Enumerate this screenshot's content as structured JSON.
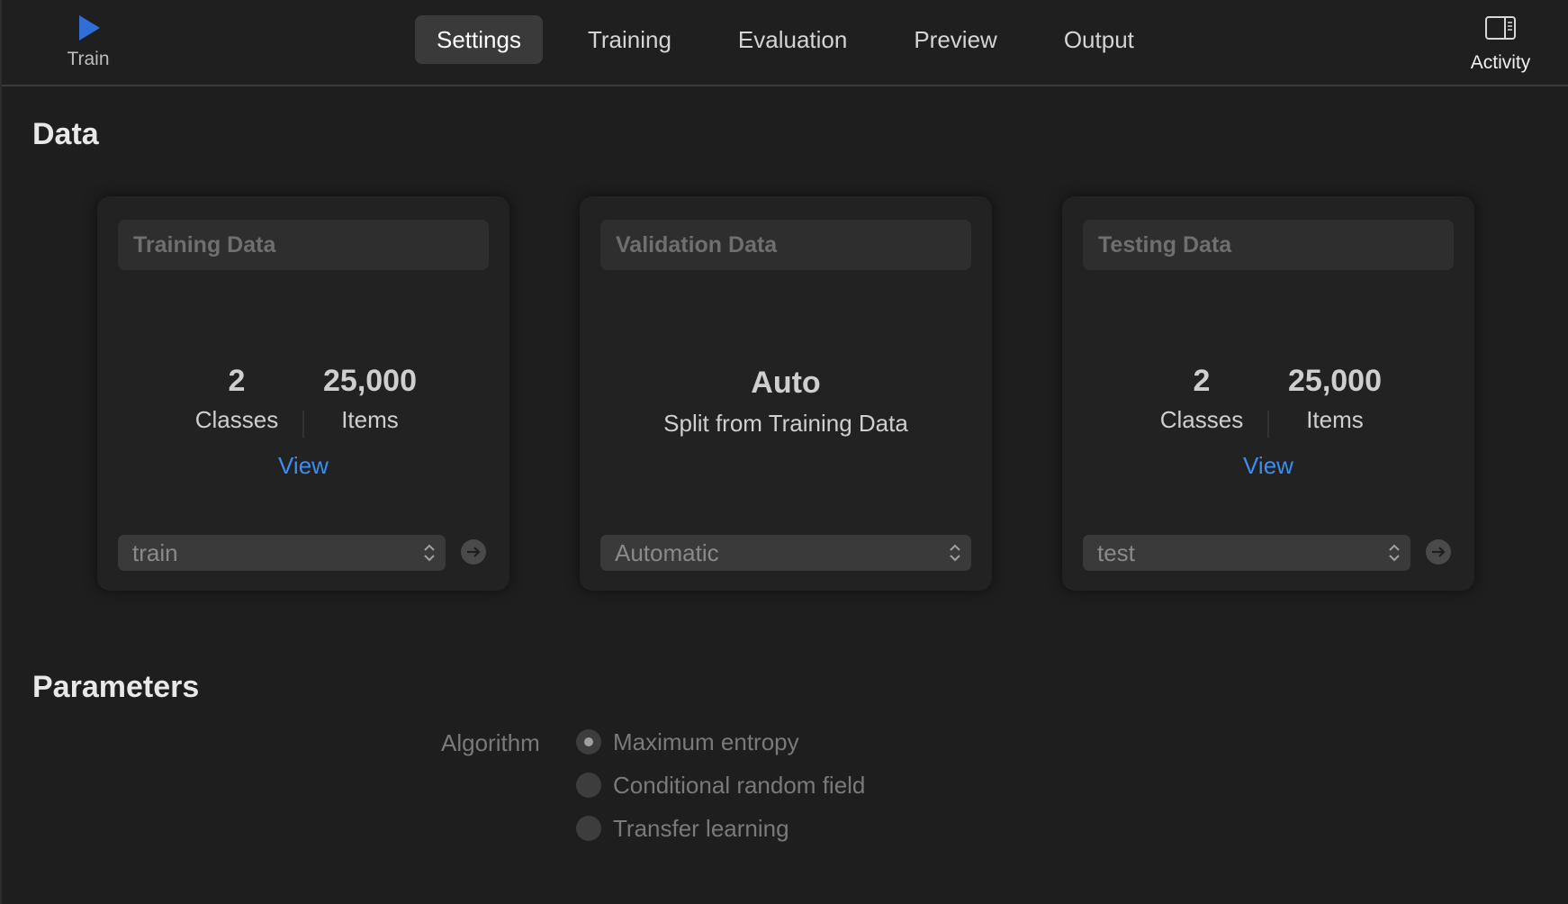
{
  "toolbar": {
    "train_label": "Train",
    "activity_label": "Activity",
    "tabs": [
      {
        "label": "Settings",
        "active": true
      },
      {
        "label": "Training",
        "active": false
      },
      {
        "label": "Evaluation",
        "active": false
      },
      {
        "label": "Preview",
        "active": false
      },
      {
        "label": "Output",
        "active": false
      }
    ],
    "accent_color": "#2f6fd6"
  },
  "data_section": {
    "title": "Data",
    "training": {
      "header": "Training Data",
      "classes_value": "2",
      "classes_label": "Classes",
      "items_value": "25,000",
      "items_label": "Items",
      "view_label": "View",
      "popup_value": "train"
    },
    "validation": {
      "header": "Validation Data",
      "mode_value": "Auto",
      "mode_label": "Split from Training Data",
      "popup_value": "Automatic"
    },
    "testing": {
      "header": "Testing Data",
      "classes_value": "2",
      "classes_label": "Classes",
      "items_value": "25,000",
      "items_label": "Items",
      "view_label": "View",
      "popup_value": "test"
    }
  },
  "parameters_section": {
    "title": "Parameters",
    "algorithm_label": "Algorithm",
    "options": [
      {
        "label": "Maximum entropy",
        "selected": true
      },
      {
        "label": "Conditional random field",
        "selected": false
      },
      {
        "label": "Transfer learning",
        "selected": false
      }
    ]
  }
}
